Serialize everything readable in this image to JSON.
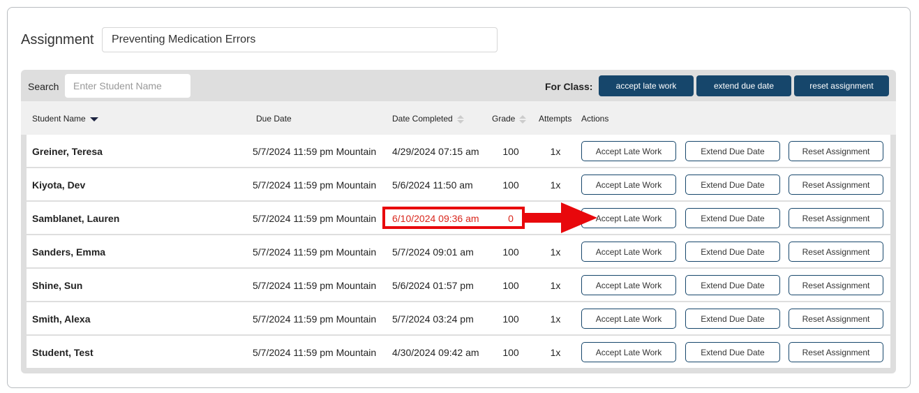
{
  "assignment": {
    "label": "Assignment",
    "value": "Preventing Medication Errors"
  },
  "toolbar": {
    "search_label": "Search",
    "search_placeholder": "Enter Student Name",
    "for_class_label": "For Class:",
    "accept": "accept late work",
    "extend": "extend due date",
    "reset": "reset assignment"
  },
  "columns": {
    "name": "Student Name",
    "due": "Due Date",
    "completed": "Date Completed",
    "grade": "Grade",
    "attempts": "Attempts",
    "actions": "Actions"
  },
  "actions": {
    "accept": "Accept Late Work",
    "extend": "Extend Due Date",
    "reset": "Reset Assignment"
  },
  "rows": [
    {
      "name": "Greiner, Teresa",
      "due": "5/7/2024 11:59 pm Mountain",
      "completed": "4/29/2024 07:15 am",
      "grade": "100",
      "attempts": "1x"
    },
    {
      "name": "Kiyota, Dev",
      "due": "5/7/2024 11:59 pm Mountain",
      "completed": "5/6/2024 11:50 am",
      "grade": "100",
      "attempts": "1x"
    },
    {
      "name": "Samblanet, Lauren",
      "due": "5/7/2024 11:59 pm Mountain",
      "completed": "6/10/2024 09:36 am",
      "grade": "0",
      "attempts": "",
      "late": true
    },
    {
      "name": "Sanders, Emma",
      "due": "5/7/2024 11:59 pm Mountain",
      "completed": "5/7/2024 09:01 am",
      "grade": "100",
      "attempts": "1x"
    },
    {
      "name": "Shine, Sun",
      "due": "5/7/2024 11:59 pm Mountain",
      "completed": "5/6/2024 01:57 pm",
      "grade": "100",
      "attempts": "1x"
    },
    {
      "name": "Smith, Alexa",
      "due": "5/7/2024 11:59 pm Mountain",
      "completed": "5/7/2024 03:24 pm",
      "grade": "100",
      "attempts": "1x"
    },
    {
      "name": "Student, Test",
      "due": "5/7/2024 11:59 pm Mountain",
      "completed": "4/30/2024 09:42 am",
      "grade": "100",
      "attempts": "1x"
    }
  ],
  "colors": {
    "brand": "#16466b",
    "late": "#d9261c",
    "highlight": "#e8080c"
  }
}
